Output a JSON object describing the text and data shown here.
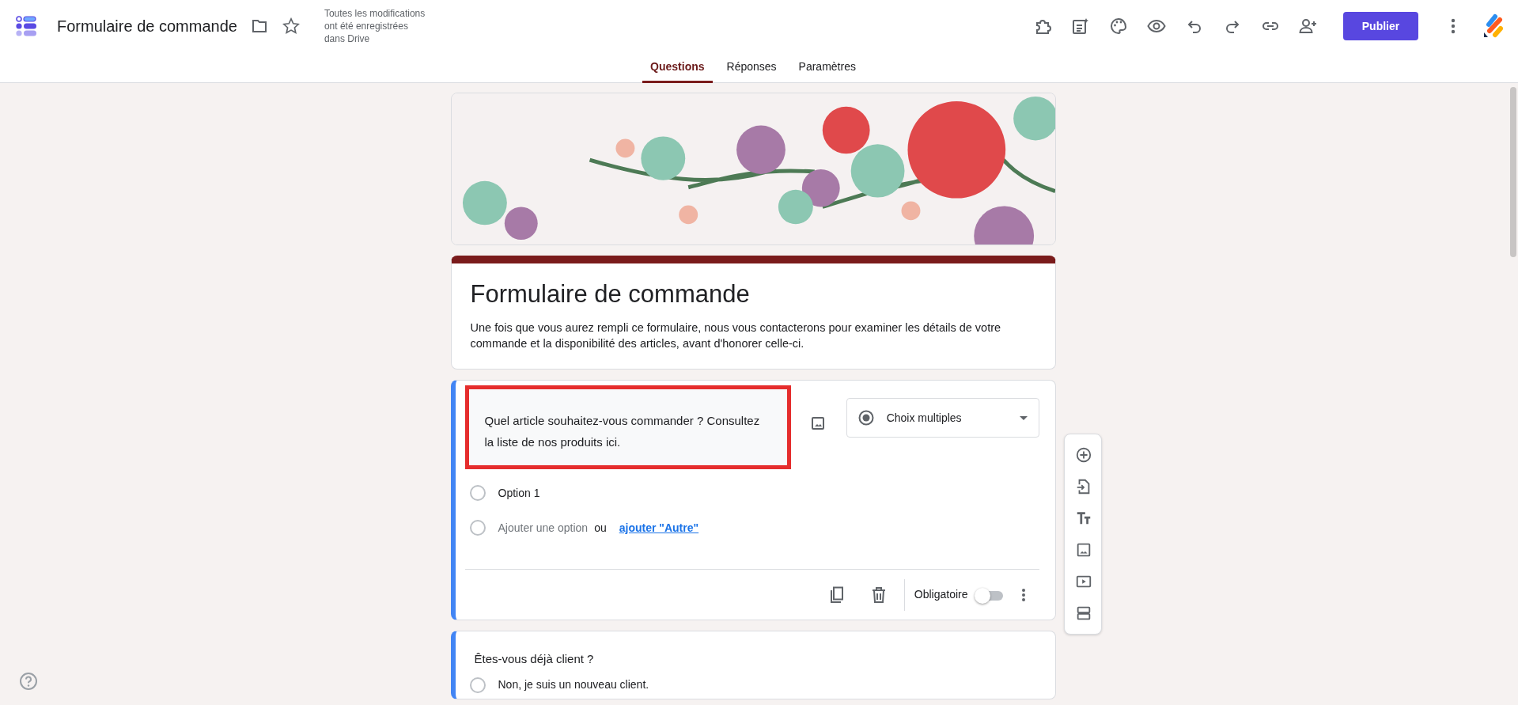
{
  "app": {
    "title": "Formulaire de commande",
    "save_status": "Toutes les modifications ont été enregistrées dans Drive",
    "starred": false
  },
  "toolbar": {
    "publish_label": "Publier"
  },
  "tabs": [
    {
      "label": "Questions",
      "selected": true
    },
    {
      "label": "Réponses",
      "selected": false
    },
    {
      "label": "Paramètres",
      "selected": false
    }
  ],
  "form": {
    "title": "Formulaire de commande",
    "description": "Une fois que vous aurez rempli ce formulaire, nous vous contacterons pour examiner les détails de votre commande et la disponibilité des articles, avant d'honorer celle-ci."
  },
  "questions": [
    {
      "text": "Quel article souhaitez-vous commander ? Consultez la liste de nos produits ici.",
      "highlighted": true,
      "type_label": "Choix multiples",
      "options": [
        {
          "label": "Option 1",
          "checked": false
        }
      ],
      "add_option": "Ajouter une option",
      "or_text": "ou",
      "add_other": "ajouter \"Autre\"",
      "required_label": "Obligatoire",
      "required": false
    },
    {
      "text": "Êtes-vous déjà client ?",
      "options": [
        {
          "label": "Non, je suis un nouveau client.",
          "checked": false
        }
      ]
    }
  ]
}
